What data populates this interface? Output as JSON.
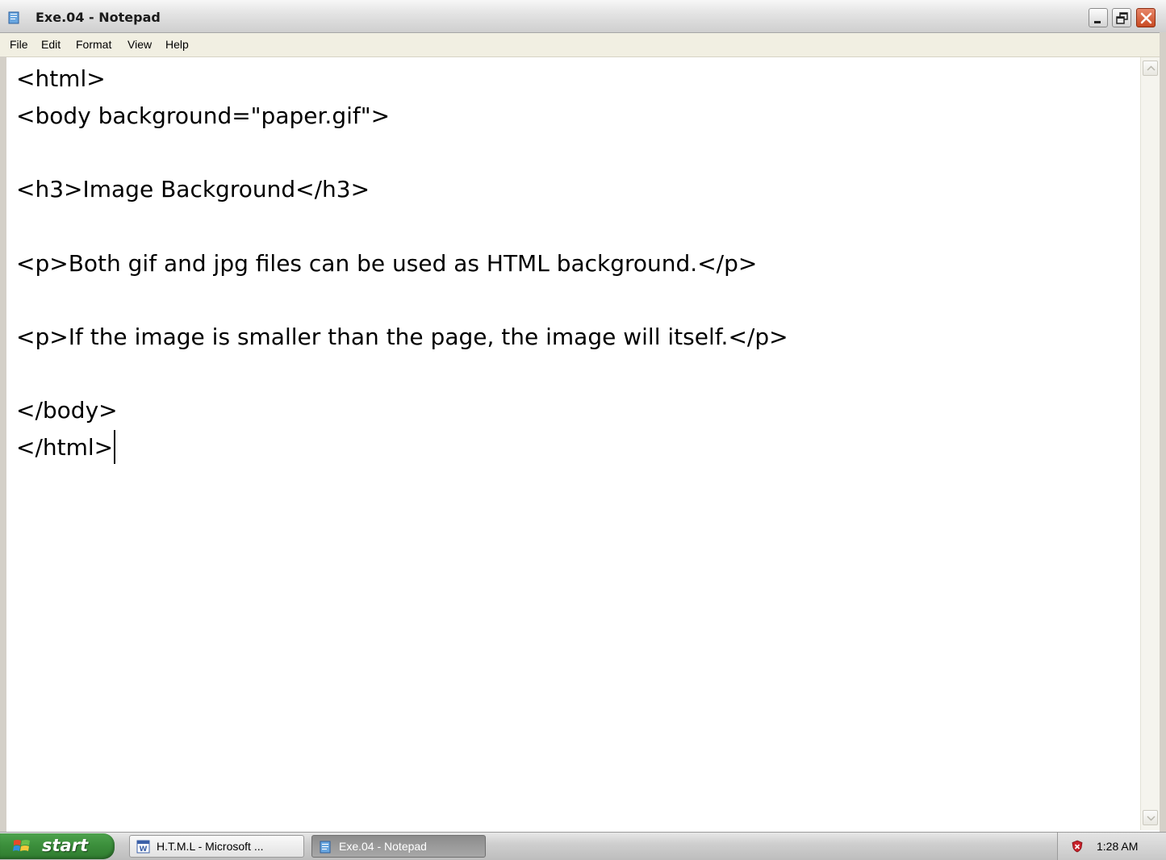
{
  "window": {
    "title": "Exe.04 - Notepad"
  },
  "menu": {
    "items": [
      "File",
      "Edit",
      "Format",
      "View",
      "Help"
    ]
  },
  "editor": {
    "lines": [
      "<html>",
      "<body background=\"paper.gif\">",
      "",
      "<h3>Image Background</h3>",
      "",
      "<p>Both gif and jpg files can be used as HTML background.</p>",
      "",
      "<p>If the image is smaller than the page, the image will itself.</p>",
      "",
      "</body>",
      "</html>"
    ]
  },
  "taskbar": {
    "start_label": "start",
    "tasks": [
      {
        "label": "H.T.M.L - Microsoft ...",
        "icon": "word-document-icon",
        "active": false
      },
      {
        "label": "Exe.04 - Notepad",
        "icon": "notepad-icon",
        "active": true
      }
    ],
    "clock": "1:28 AM"
  },
  "colors": {
    "titlebar": "#e2e2e2",
    "close_button": "#c84a22",
    "start_button": "#3c8f3c",
    "menubar": "#f1efe2"
  }
}
